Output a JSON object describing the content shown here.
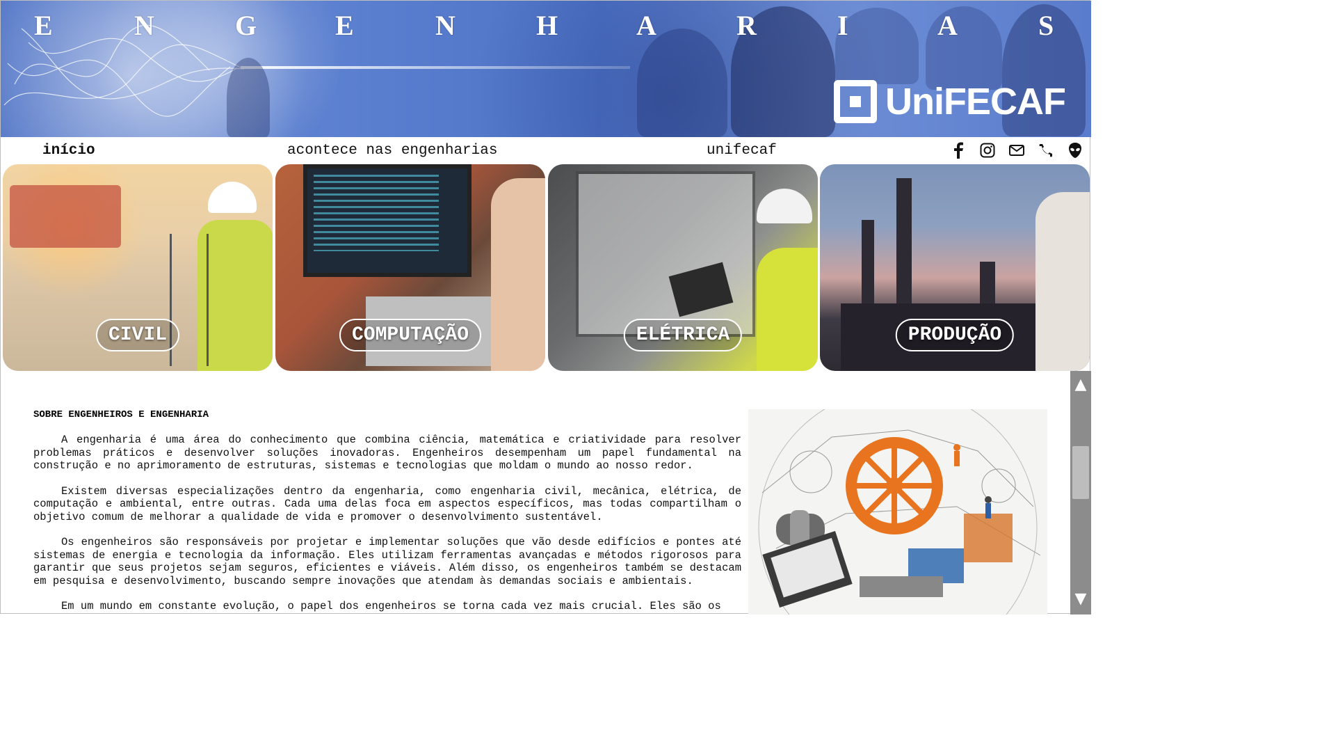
{
  "banner": {
    "title_letters": [
      "E",
      "N",
      "G",
      "E",
      "N",
      "H",
      "A",
      "R",
      "I",
      "A",
      "S"
    ],
    "logo_text": "UniFECAF"
  },
  "nav": {
    "home": "início",
    "news": "acontece nas engenharias",
    "unifecaf": "unifecaf"
  },
  "social": {
    "icons": [
      "facebook-icon",
      "instagram-icon",
      "mail-icon",
      "phone-icon",
      "alien-icon"
    ]
  },
  "cards": [
    {
      "label": "CIVIL"
    },
    {
      "label": "COMPUTAÇÃO"
    },
    {
      "label": "ELÉTRICA"
    },
    {
      "label": "PRODUÇÃO"
    }
  ],
  "article": {
    "heading": "SOBRE ENGENHEIROS E ENGENHARIA",
    "paragraphs": [
      "A engenharia é uma área do conhecimento que combina ciência, matemática e criatividade para resolver problemas práticos e desenvolver soluções inovadoras. Engenheiros desempenham um papel fundamental na construção e no aprimoramento de estruturas, sistemas e tecnologias que moldam o mundo ao nosso redor.",
      "Existem diversas especializações dentro da engenharia, como engenharia civil, mecânica, elétrica, de computação e ambiental, entre outras. Cada uma delas foca em aspectos específicos, mas todas compartilham o objetivo comum de melhorar a qualidade de vida e promover o desenvolvimento sustentável.",
      "Os engenheiros são responsáveis por projetar e implementar soluções que vão desde edifícios e pontes até sistemas de energia e tecnologia da informação. Eles utilizam ferramentas avançadas e métodos rigorosos para garantir que seus projetos sejam seguros, eficientes e viáveis. Além disso, os engenheiros também se destacam em pesquisa e desenvolvimento, buscando sempre inovações que atendam às demandas sociais e ambientais.",
      "Em um mundo em constante evolução, o papel dos engenheiros se torna cada vez mais crucial. Eles são os"
    ]
  },
  "colors": {
    "banner_blue": "#4a6fc4",
    "scrollbar": "#8c8c8c",
    "text": "#111111"
  }
}
